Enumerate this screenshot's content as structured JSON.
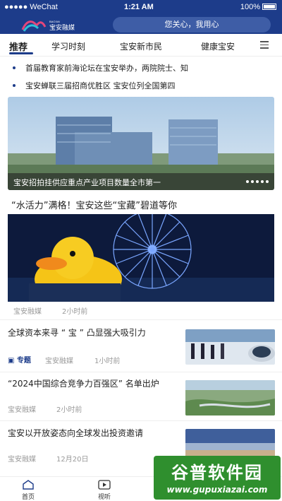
{
  "status": {
    "carrier": "●●●●● WeChat",
    "time": "1:21 AM",
    "battery": "100%"
  },
  "header": {
    "logo_small": "BAO'AN",
    "logo_text": "宝安融媒",
    "search_placeholder": "您关心，我用心"
  },
  "tabs": [
    "推荐",
    "学习时刻",
    "宝安新市民",
    "健康宝安"
  ],
  "news_ticker": [
    "首届教育家前海论坛在宝安举办，两院院士、知",
    "宝安蝉联三届招商优胜区    宝安位列全国第四"
  ],
  "banner": {
    "caption": "宝安招拍挂供应重点产业项目数量全市第一"
  },
  "headline": "“水活力”满格！宝安这些“宝藏”碧道等你",
  "hero_meta": {
    "source": "宝安融媒",
    "time": "2小时前"
  },
  "articles": [
    {
      "title": "全球资本来寻 “ 宝 ” 凸显强大吸引力",
      "tag": "专题",
      "source": "宝安融媒",
      "time": "1小时前"
    },
    {
      "title": "“2024中国综合竞争力百强区” 名单出炉",
      "source": "宝安融媒",
      "time": "2小时前"
    },
    {
      "title": "宝安以开放姿态向全球发出投资邀请",
      "source": "宝安融媒",
      "time": "12月20日"
    }
  ],
  "bottom_nav": [
    {
      "label": "首页"
    },
    {
      "label": "视听"
    }
  ],
  "watermark": {
    "line1": "谷普软件园",
    "line2": "www.gupuxiazai.com"
  },
  "colors": {
    "brand": "#1d3c8a",
    "watermark": "#2f8f2e"
  }
}
